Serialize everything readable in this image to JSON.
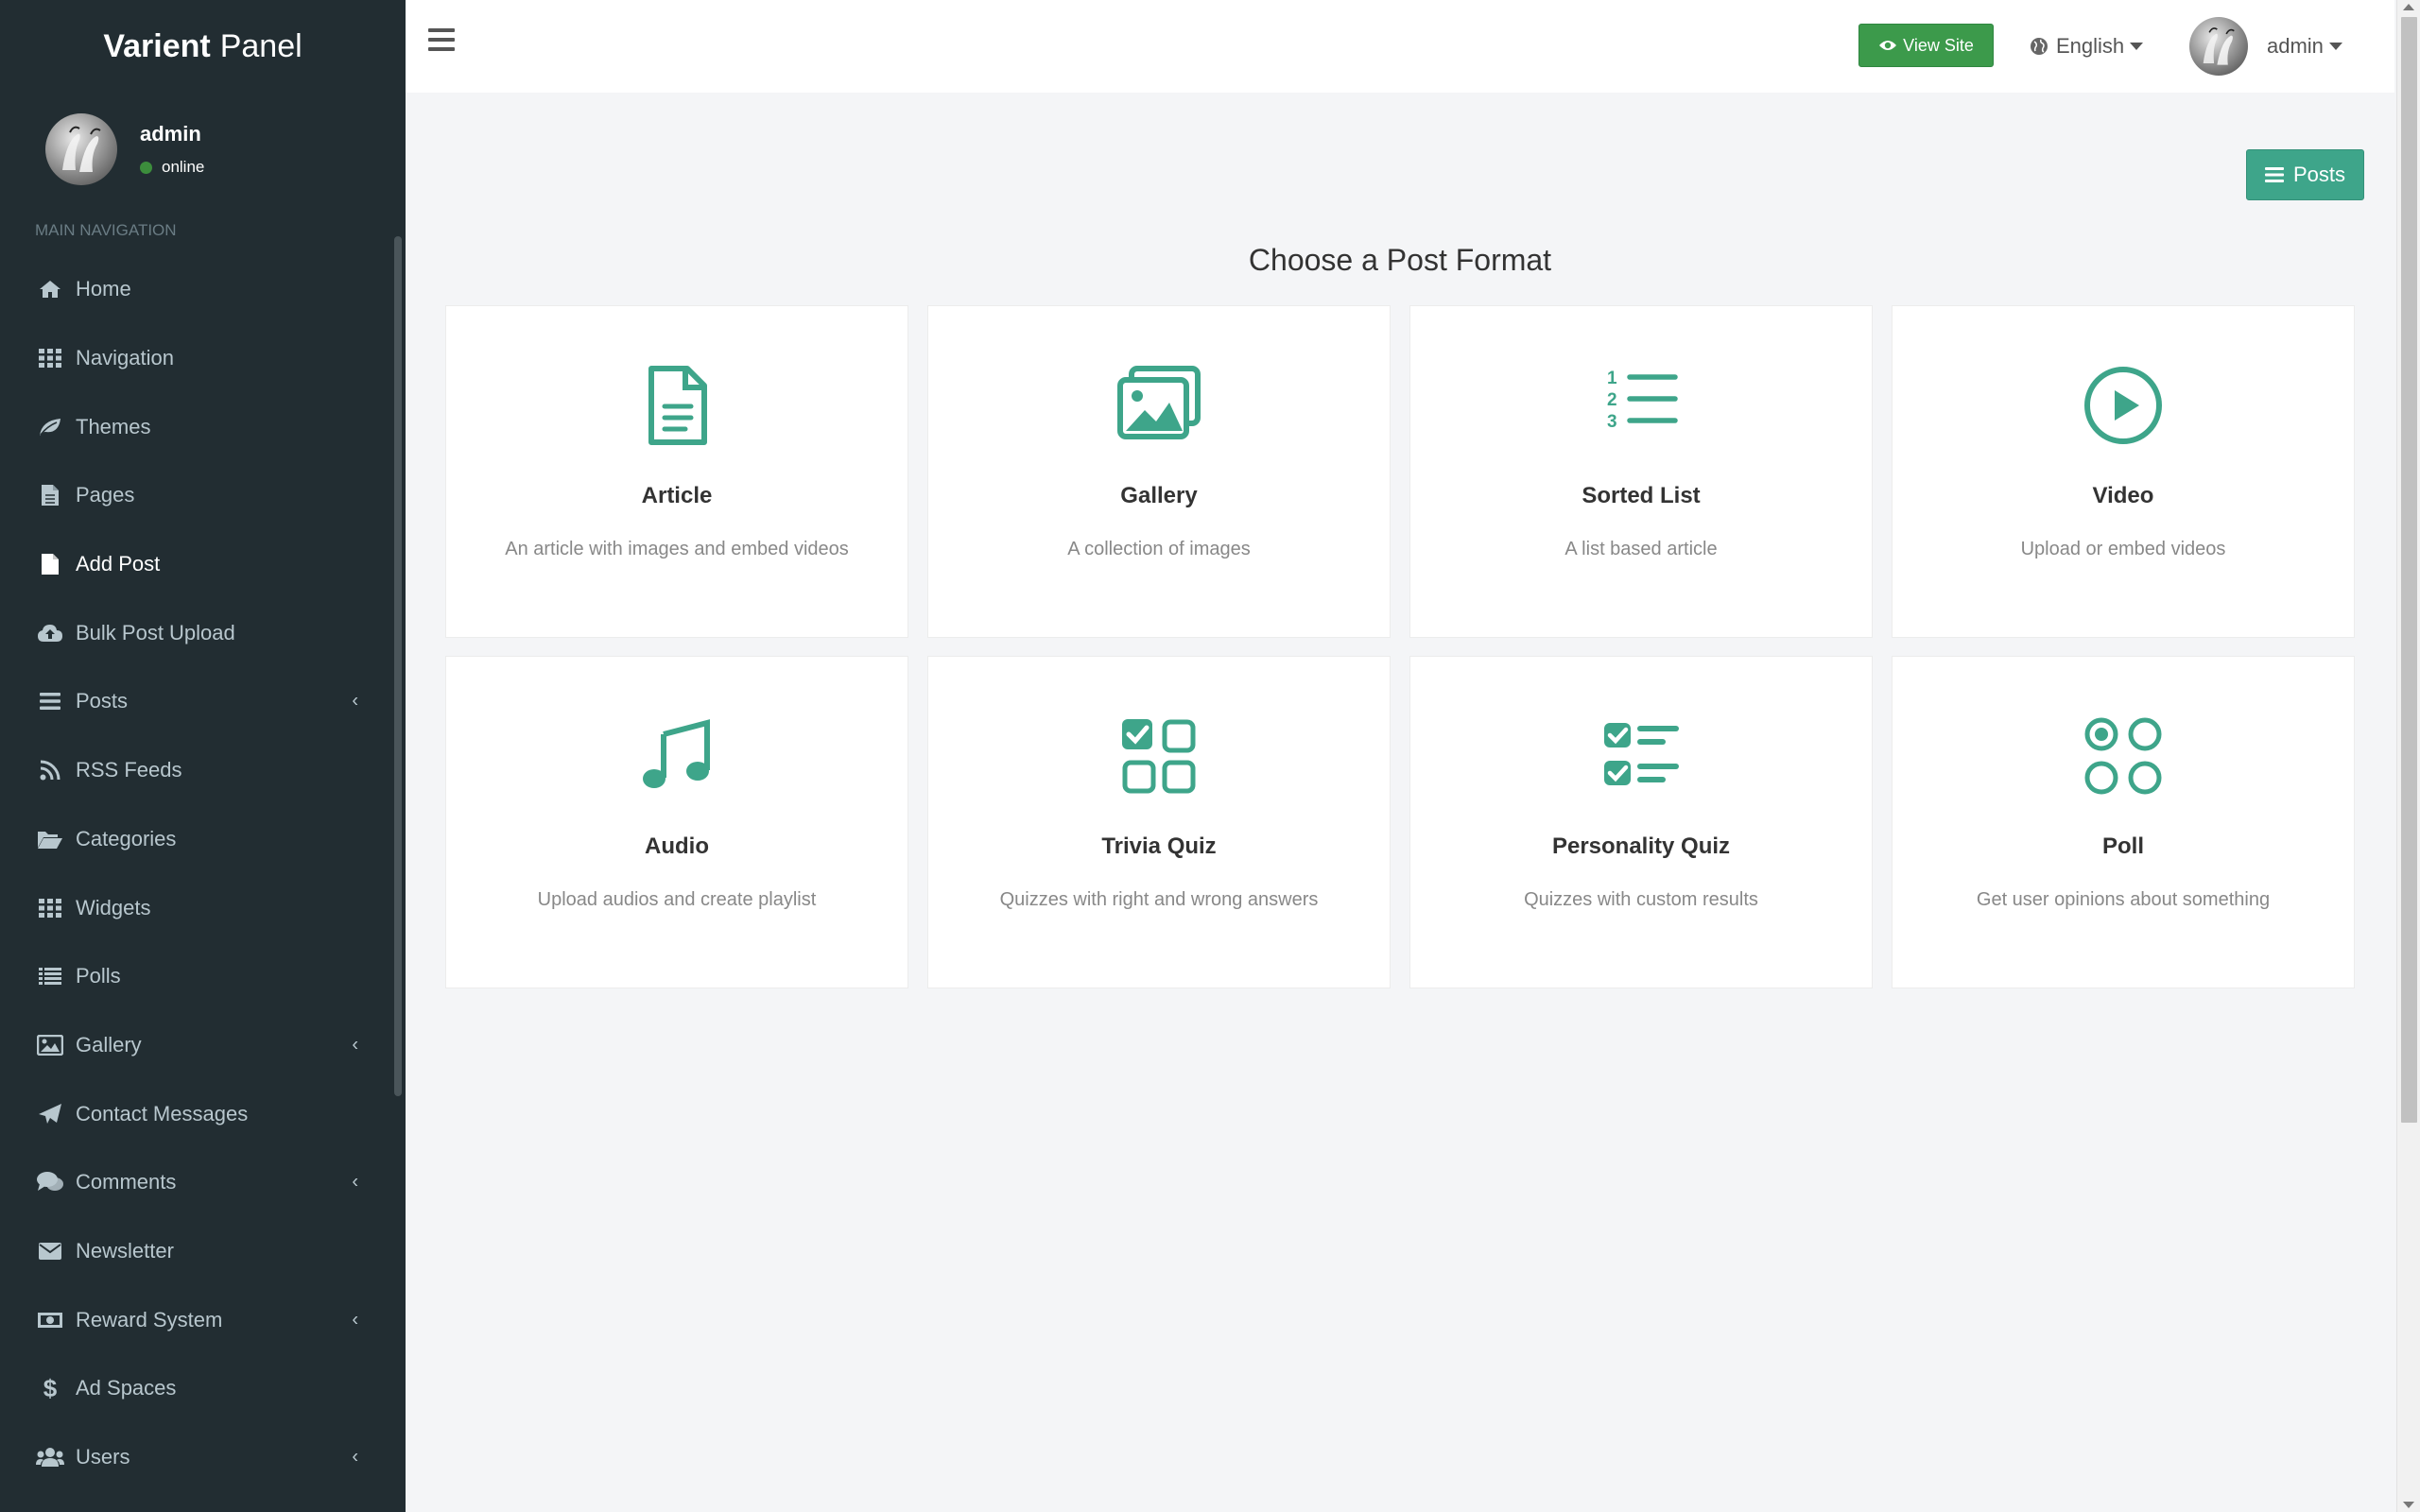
{
  "brand": {
    "bold": "Varient",
    "light": "Panel"
  },
  "user": {
    "name": "admin",
    "status": "online"
  },
  "nav_header": "MAIN NAVIGATION",
  "nav": [
    {
      "label": "Home",
      "icon": "home-icon"
    },
    {
      "label": "Navigation",
      "icon": "grid-icon"
    },
    {
      "label": "Themes",
      "icon": "leaf-icon"
    },
    {
      "label": "Pages",
      "icon": "file-icon"
    },
    {
      "label": "Add Post",
      "icon": "file-icon",
      "active": true
    },
    {
      "label": "Bulk Post Upload",
      "icon": "cloud-upload-icon"
    },
    {
      "label": "Posts",
      "icon": "bars-icon",
      "expandable": true
    },
    {
      "label": "RSS Feeds",
      "icon": "rss-icon"
    },
    {
      "label": "Categories",
      "icon": "folder-open-icon"
    },
    {
      "label": "Widgets",
      "icon": "grid-icon"
    },
    {
      "label": "Polls",
      "icon": "list-icon"
    },
    {
      "label": "Gallery",
      "icon": "image-icon",
      "expandable": true
    },
    {
      "label": "Contact Messages",
      "icon": "paper-plane-icon"
    },
    {
      "label": "Comments",
      "icon": "comments-icon",
      "expandable": true
    },
    {
      "label": "Newsletter",
      "icon": "envelope-icon"
    },
    {
      "label": "Reward System",
      "icon": "money-icon",
      "expandable": true
    },
    {
      "label": "Ad Spaces",
      "icon": "dollar-icon"
    },
    {
      "label": "Users",
      "icon": "users-icon",
      "expandable": true
    }
  ],
  "topbar": {
    "view_site": "View Site",
    "language": "English",
    "user": "admin"
  },
  "posts_button": "Posts",
  "page_title": "Choose a Post Format",
  "formats": [
    {
      "title": "Article",
      "desc": "An article with images and embed videos",
      "icon": "article-icon"
    },
    {
      "title": "Gallery",
      "desc": "A collection of images",
      "icon": "gallery-icon"
    },
    {
      "title": "Sorted List",
      "desc": "A list based article",
      "icon": "sorted-list-icon"
    },
    {
      "title": "Video",
      "desc": "Upload or embed videos",
      "icon": "play-circle-icon"
    },
    {
      "title": "Audio",
      "desc": "Upload audios and create playlist",
      "icon": "music-note-icon"
    },
    {
      "title": "Trivia Quiz",
      "desc": "Quizzes with right and wrong answers",
      "icon": "trivia-quiz-icon"
    },
    {
      "title": "Personality Quiz",
      "desc": "Quizzes with custom results",
      "icon": "personality-quiz-icon"
    },
    {
      "title": "Poll",
      "desc": "Get user opinions about something",
      "icon": "poll-icon"
    }
  ],
  "colors": {
    "sidebar_bg": "#222d32",
    "accent_teal": "#3ea58a",
    "view_site_green": "#3c9a4b",
    "status_green": "#3c8d3c"
  }
}
